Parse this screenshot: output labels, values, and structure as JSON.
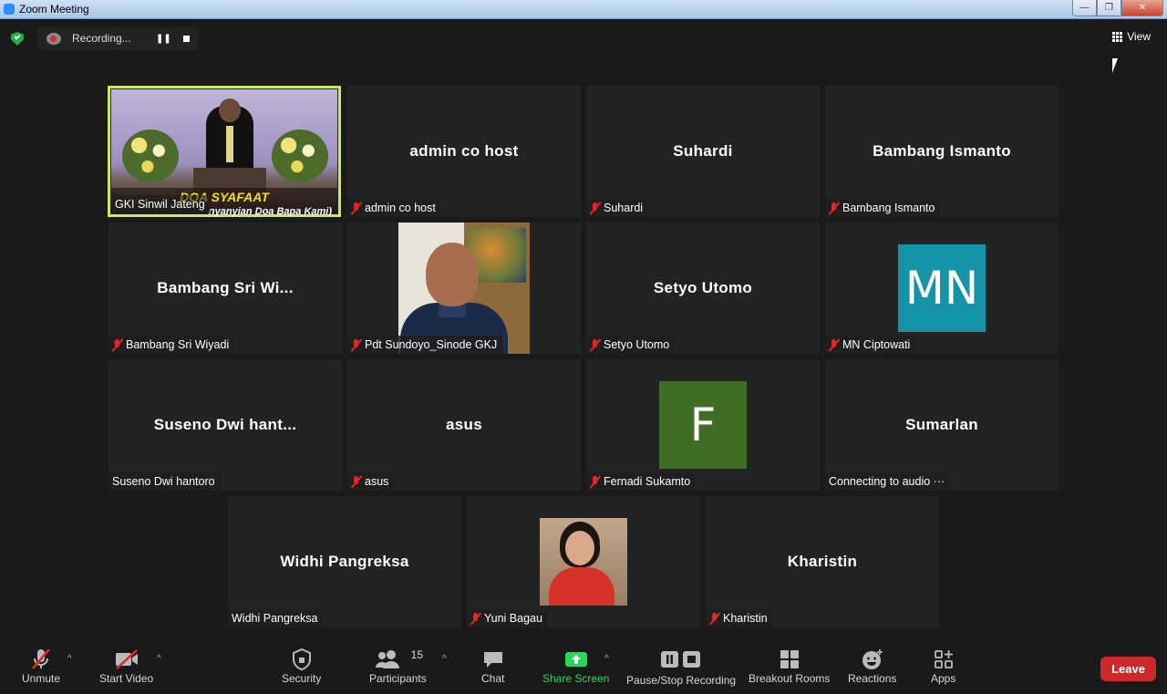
{
  "window": {
    "title": "Zoom Meeting"
  },
  "recording": {
    "label": "Recording..."
  },
  "view": {
    "label": "View"
  },
  "tiles": [
    {
      "center": "",
      "plate": "GKI Sinwil Jateng",
      "banner_title": "DOA SYAFAAT",
      "banner_sub": "nyanyian Doa Bapa Kami)",
      "muted": false
    },
    {
      "center": "admin co host",
      "plate": "admin co host",
      "muted": true
    },
    {
      "center": "Suhardi",
      "plate": "Suhardi",
      "muted": true
    },
    {
      "center": "Bambang Ismanto",
      "plate": "Bambang Ismanto",
      "muted": true
    },
    {
      "center": "Bambang Sri Wi...",
      "plate": "Bambang Sri Wiyadi",
      "muted": true
    },
    {
      "center": "",
      "plate": "Pdt Sundoyo_Sinode GKJ",
      "muted": true
    },
    {
      "center": "Setyo Utomo",
      "plate": "Setyo Utomo",
      "muted": true
    },
    {
      "center": "",
      "avatar_text": "MN",
      "avatar_color": "#1594a8",
      "plate": "MN Ciptowati",
      "muted": true
    },
    {
      "center": "Suseno Dwi hant...",
      "plate": "Suseno Dwi hantoro",
      "muted": false
    },
    {
      "center": "asus",
      "plate": "asus",
      "muted": true
    },
    {
      "center": "",
      "avatar_text": "F",
      "avatar_color": "#3d6e24",
      "plate": "Fernadi Sukamto",
      "muted": true
    },
    {
      "center": "Sumarlan",
      "plate": "Connecting to audio ···",
      "muted": false
    },
    {
      "center": "Widhi Pangreksa",
      "plate": "Widhi Pangreksa",
      "muted": false
    },
    {
      "center": "",
      "plate": "Yuni Bagau",
      "muted": true
    },
    {
      "center": "Kharistin",
      "plate": "Kharistin",
      "muted": true
    }
  ],
  "toolbar": {
    "unmute": "Unmute",
    "start_video": "Start Video",
    "security": "Security",
    "participants": "Participants",
    "participants_count": "15",
    "chat": "Chat",
    "share_screen": "Share Screen",
    "pause_stop": "Pause/Stop Recording",
    "breakout": "Breakout Rooms",
    "reactions": "Reactions",
    "apps": "Apps",
    "leave": "Leave"
  },
  "colors": {
    "share_green": "#23d959",
    "leave_red": "#cc2a2a",
    "active_speaker": "#c8e866",
    "muted_red": "#e02828"
  }
}
